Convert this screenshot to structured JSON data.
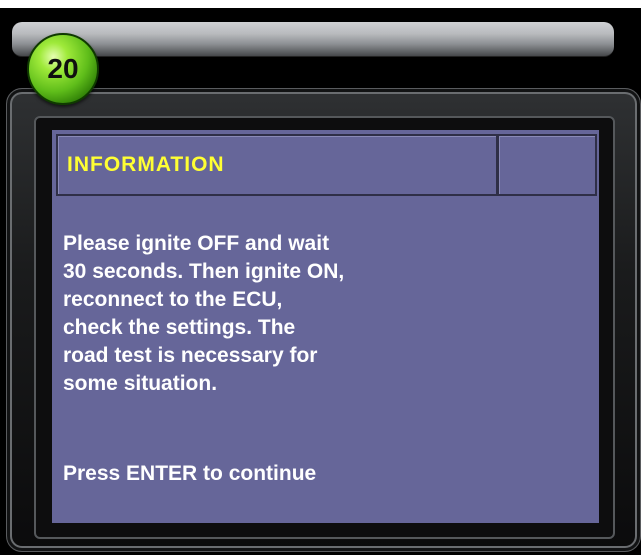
{
  "step": {
    "number": "20"
  },
  "dialog": {
    "title": "INFORMATION",
    "message": "Please ignite OFF and wait\n30 seconds. Then ignite ON,\nreconnect to the ECU,\ncheck the settings. The\nroad test is necessary for\nsome situation.",
    "prompt": "Press ENTER to continue"
  },
  "colors": {
    "panel": "#666699",
    "title_text": "#ffff33",
    "body_text": "#ffffff",
    "badge_green": "#5fbd1a"
  }
}
